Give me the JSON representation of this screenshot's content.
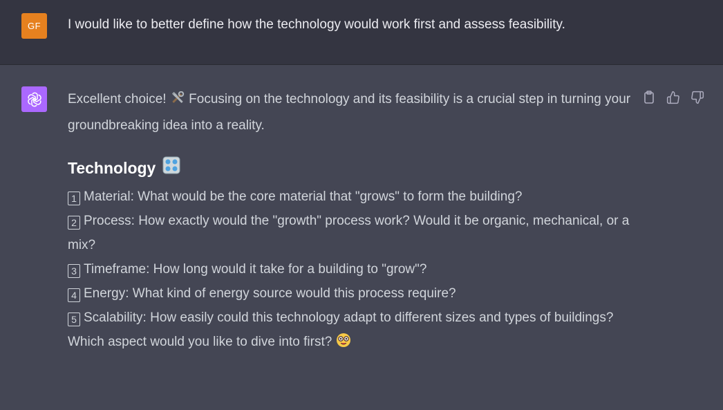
{
  "user": {
    "avatar_initials": "GF",
    "avatar_color": "#e6811f",
    "message": "I would like to better define how the technology would work first and assess feasibility."
  },
  "assistant": {
    "avatar_icon": "openai-logo-icon",
    "avatar_color": "#ab68ff",
    "intro_part1": "Excellent choice!",
    "intro_emoji": "hammer-and-wrench-icon",
    "intro_part2": "Focusing on the technology and its feasibility is a crucial step in turning your groundbreaking idea into a reality.",
    "heading": "Technology",
    "heading_emoji": "control-knobs-icon",
    "items": [
      {
        "num": "1",
        "text": "Material: What would be the core material that \"grows\" to form the building?"
      },
      {
        "num": "2",
        "text": "Process: How exactly would the \"growth\" process work? Would it be organic, mechanical, or a mix?"
      },
      {
        "num": "3",
        "text": "Timeframe: How long would it take for a building to \"grow\"?"
      },
      {
        "num": "4",
        "text": "Energy: What kind of energy source would this process require?"
      },
      {
        "num": "5",
        "text": "Scalability: How easily could this technology adapt to different sizes and types of buildings?"
      }
    ],
    "closing": "Which aspect would you like to dive into first?",
    "closing_emoji": "nerd-face-icon"
  },
  "actions": {
    "icons": [
      "clipboard-icon",
      "thumbs-up-icon",
      "thumbs-down-icon"
    ]
  },
  "colors": {
    "user_bg": "#343541",
    "assistant_bg": "#444654",
    "text": "#d1d5db"
  }
}
